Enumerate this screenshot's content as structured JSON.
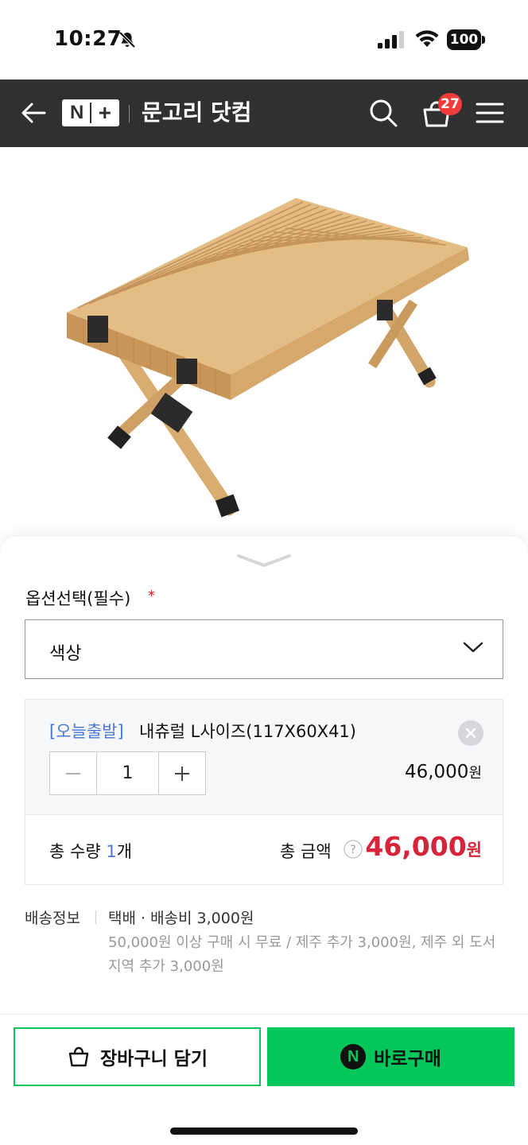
{
  "status_bar": {
    "time": "10:27",
    "battery": "100"
  },
  "header": {
    "brand_letter": "N",
    "brand_plus": "+",
    "store_name": "문고리 닷컴",
    "cart_count": "27",
    "icons": [
      "back-icon",
      "search-icon",
      "cart-icon",
      "menu-icon"
    ]
  },
  "product": {
    "image_alt": "wooden roll-top folding camping table"
  },
  "options": {
    "label": "옵션선택(필수)",
    "required_mark": "*",
    "select_value": "색상"
  },
  "selected_item": {
    "tag": "[오늘출발]",
    "name": "내츄럴 L사이즈(117X60X41)",
    "quantity": "1",
    "price": "46,000",
    "price_unit": "원"
  },
  "totals": {
    "qty_prefix": "총 수량 ",
    "qty_value": "1",
    "qty_suffix": "개",
    "amount_label": "총 금액",
    "amount": "46,000",
    "amount_unit": "원"
  },
  "shipping": {
    "label": "배송정보",
    "fee": "택배 · 배송비 3,000원",
    "note": "50,000원 이상 구매 시 무료 / 제주 추가 3,000원, 제주 외 도서지역 추가 3,000원"
  },
  "buttons": {
    "cart_label": "장바구니 담기",
    "buy_label": "바로구매",
    "npay_letter": "N"
  },
  "colors": {
    "header_bg": "#2f3030",
    "accent_green": "#03c75a",
    "price_red": "#d6253a",
    "tag_blue": "#4a78d4",
    "badge_red": "#f23b3b"
  }
}
